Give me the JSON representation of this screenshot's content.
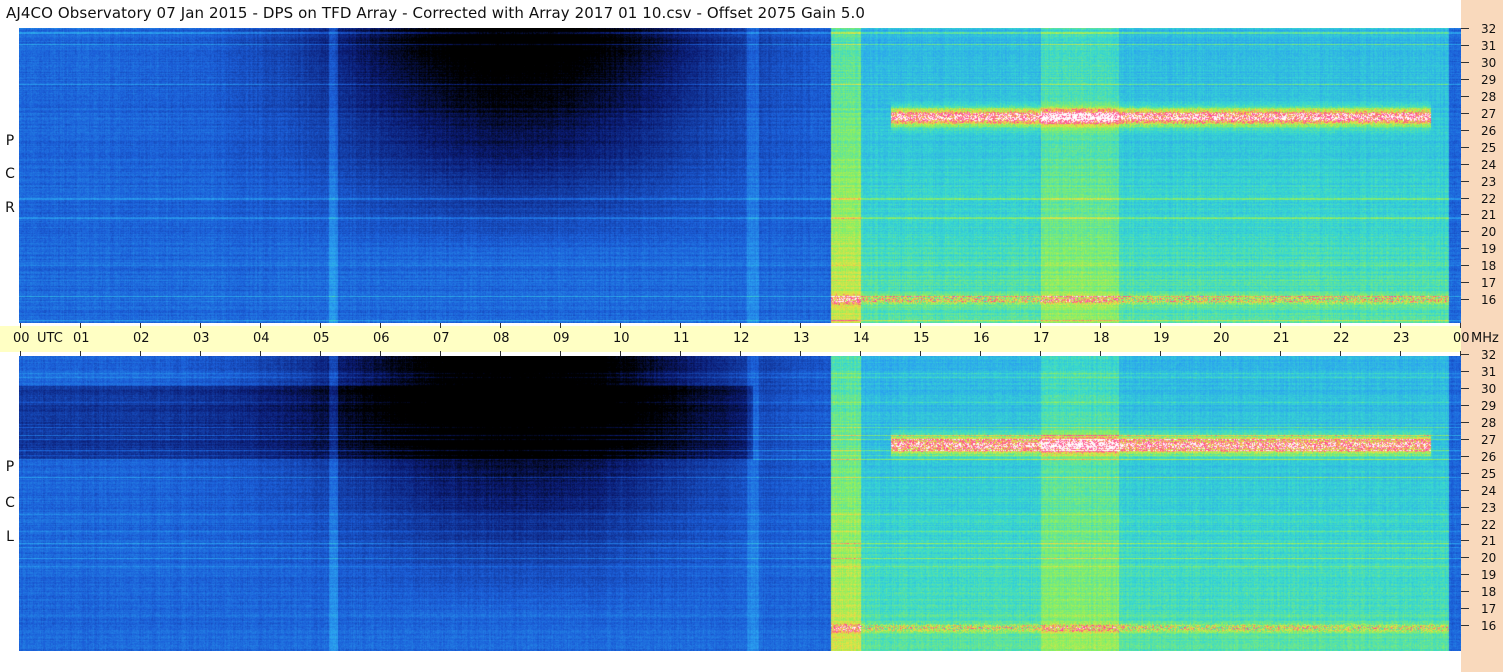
{
  "header": {
    "title": "AJ4CO Observatory  07 Jan 2015  -  DPS on TFD Array  -  Corrected with Array 2017 01 10.csv  -  Offset 2075  Gain 5.0"
  },
  "chart_data": [
    {
      "type": "heatmap",
      "name": "RCP",
      "polarization_label": [
        "R",
        "C",
        "P"
      ],
      "x_unit": "UTC",
      "x_range": [
        "00",
        "00"
      ],
      "y_unit": "MHz",
      "y_range": [
        16,
        32
      ],
      "colormap": [
        "#000000",
        "#0a1a70",
        "#1b5ed8",
        "#2aa0f0",
        "#38d8d0",
        "#8df060",
        "#f0e040",
        "#ff4090",
        "#ffffff"
      ]
    },
    {
      "type": "heatmap",
      "name": "LCP",
      "polarization_label": [
        "L",
        "C",
        "P"
      ],
      "x_unit": "UTC",
      "x_range": [
        "00",
        "00"
      ],
      "y_unit": "MHz",
      "y_range": [
        16,
        32
      ],
      "colormap": [
        "#000000",
        "#0a1a70",
        "#1b5ed8",
        "#2aa0f0",
        "#38d8d0",
        "#8df060",
        "#f0e040",
        "#ff4090",
        "#ffffff"
      ]
    }
  ],
  "time_axis": {
    "labels": [
      "00",
      "UTC",
      "01",
      "02",
      "03",
      "04",
      "05",
      "06",
      "07",
      "08",
      "09",
      "10",
      "11",
      "12",
      "13",
      "14",
      "15",
      "16",
      "17",
      "18",
      "19",
      "20",
      "21",
      "22",
      "23",
      "00",
      "MHz"
    ]
  },
  "freq_axis": {
    "labels": [
      "32",
      "31",
      "30",
      "29",
      "28",
      "27",
      "26",
      "25",
      "24",
      "23",
      "22",
      "21",
      "20",
      "19",
      "18",
      "17",
      "16"
    ]
  }
}
